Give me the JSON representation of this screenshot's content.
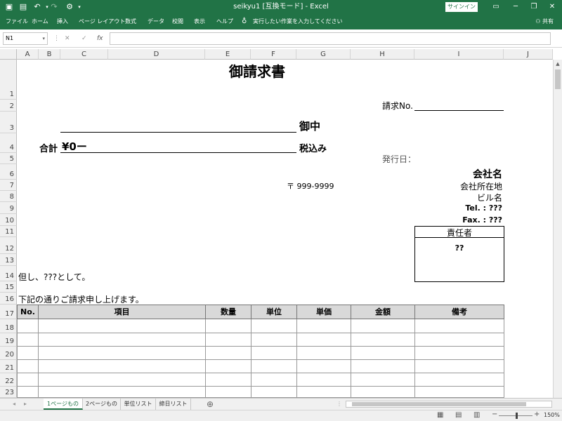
{
  "titlebar": {
    "title": "seikyu1  [互換モード]  -  Excel",
    "signin": "サインイン"
  },
  "ribbon": {
    "tabs": [
      "ファイル",
      "ホーム",
      "挿入",
      "ページ レイアウト",
      "数式",
      "データ",
      "校閲",
      "表示",
      "ヘルプ"
    ],
    "tell_me": "実行したい作業を入力してください",
    "share": "共有"
  },
  "formula_bar": {
    "name_box": "N1",
    "formula": ""
  },
  "columns": [
    "A",
    "B",
    "C",
    "D",
    "E",
    "F",
    "G",
    "H",
    "I",
    "J"
  ],
  "rows": [
    "1",
    "2",
    "3",
    "4",
    "5",
    "6",
    "7",
    "8",
    "9",
    "10",
    "11",
    "12",
    "13",
    "14",
    "15",
    "16",
    "17",
    "18",
    "19",
    "20",
    "21",
    "22",
    "23"
  ],
  "invoice": {
    "title": "御請求書",
    "invoice_no_label": "請求No.",
    "recipient_suffix": "御中",
    "total_label": "合計",
    "total_value": "¥0ー",
    "tax_included": "税込み",
    "issue_date_label": "発行日：",
    "company_name": "会社名",
    "postal": "〒 999-9999",
    "company_address": "会社所在地",
    "building": "ビル名",
    "tel": "Tel. : ???",
    "fax": "Fax. : ???",
    "person_in_charge_label": "責任者",
    "person_in_charge_value": "??",
    "note": "但し、???として。",
    "intro": "下記の通りご請求申し上げます。"
  },
  "table": {
    "headers": [
      "No.",
      "項目",
      "数量",
      "単位",
      "単価",
      "金額",
      "備考"
    ]
  },
  "sheet_tabs": [
    "1ページもの",
    "2ページもの",
    "単位リスト",
    "締日リスト"
  ],
  "status": {
    "zoom": "150%"
  }
}
